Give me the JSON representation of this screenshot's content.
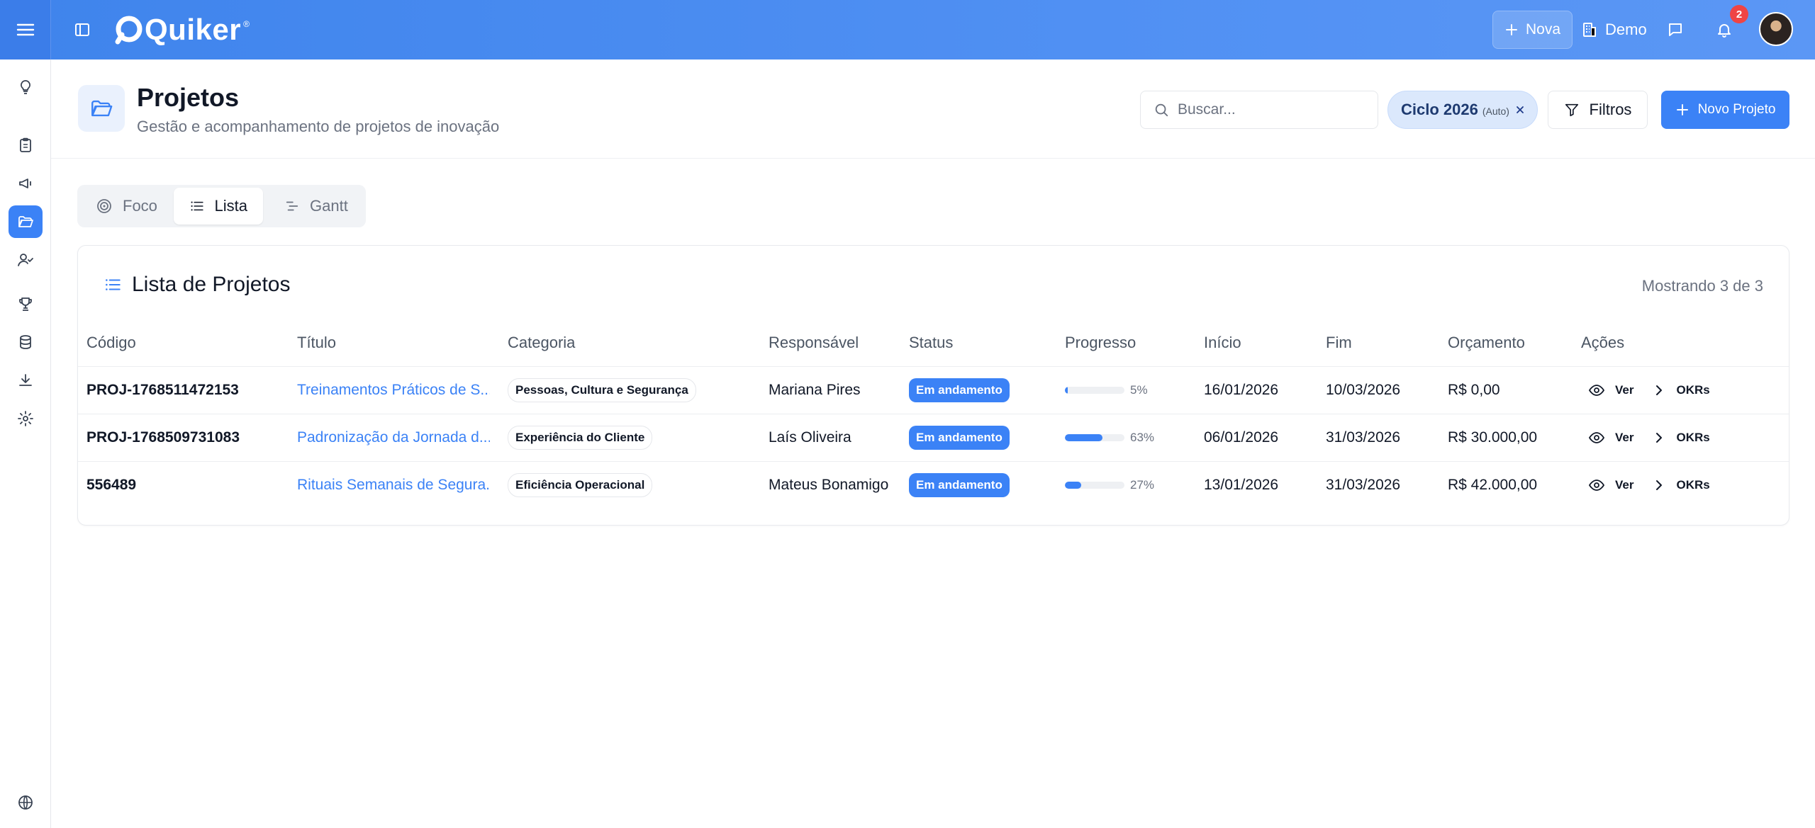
{
  "brand": {
    "name": "Quiker",
    "reg": "®"
  },
  "topbar": {
    "new_label": "Nova",
    "org_label": "Demo",
    "notifications_count": "2"
  },
  "header": {
    "title": "Projetos",
    "subtitle": "Gestão e acompanhamento de projetos de inovação",
    "search_placeholder": "Buscar...",
    "cycle_chip_label": "Ciclo 2026",
    "cycle_chip_sub": "(Auto)",
    "filters_label": "Filtros",
    "new_project_label": "Novo Projeto"
  },
  "tabs": [
    {
      "label": "Foco",
      "icon": "target-icon"
    },
    {
      "label": "Lista",
      "icon": "list-icon"
    },
    {
      "label": "Gantt",
      "icon": "gantt-icon"
    }
  ],
  "card": {
    "title": "Lista de Projetos",
    "count_text": "Mostrando 3 de 3"
  },
  "table": {
    "columns": [
      "Código",
      "Título",
      "Categoria",
      "Responsável",
      "Status",
      "Progresso",
      "Início",
      "Fim",
      "Orçamento",
      "Ações"
    ],
    "rows": [
      {
        "code": "PROJ-1768511472153",
        "title": "Treinamentos Práticos de S...",
        "category": "Pessoas, Cultura e Segurança",
        "owner": "Mariana Pires",
        "status": "Em andamento",
        "progress": 5,
        "progress_text": "5%",
        "start": "16/01/2026",
        "end": "10/03/2026",
        "budget": "R$ 0,00",
        "view_label": "Ver",
        "okrs_label": "OKRs"
      },
      {
        "code": "PROJ-1768509731083",
        "title": "Padronização da Jornada d...",
        "category": "Experiência do Cliente",
        "owner": "Laís Oliveira",
        "status": "Em andamento",
        "progress": 63,
        "progress_text": "63%",
        "start": "06/01/2026",
        "end": "31/03/2026",
        "budget": "R$ 30.000,00",
        "view_label": "Ver",
        "okrs_label": "OKRs"
      },
      {
        "code": "556489",
        "title": "Rituais Semanais de Segura...",
        "category": "Eficiência Operacional",
        "owner": "Mateus Bonamigo",
        "status": "Em andamento",
        "progress": 27,
        "progress_text": "27%",
        "start": "13/01/2026",
        "end": "31/03/2026",
        "budget": "R$ 42.000,00",
        "view_label": "Ver",
        "okrs_label": "OKRs"
      }
    ]
  },
  "sidebar": {
    "items": [
      {
        "icon": "lightbulb-icon"
      },
      {
        "icon": "clipboard-icon"
      },
      {
        "icon": "megaphone-icon"
      },
      {
        "icon": "folder-icon",
        "active": true
      },
      {
        "icon": "user-check-icon"
      },
      {
        "icon": "trophy-icon"
      },
      {
        "icon": "database-icon"
      },
      {
        "icon": "download-icon"
      },
      {
        "icon": "settings-icon"
      },
      {
        "icon": "globe-icon"
      }
    ]
  },
  "colors": {
    "brand_blue": "#3b82f6",
    "topbar_blue": "#4a8cf0",
    "badge_red": "#ef4444"
  }
}
